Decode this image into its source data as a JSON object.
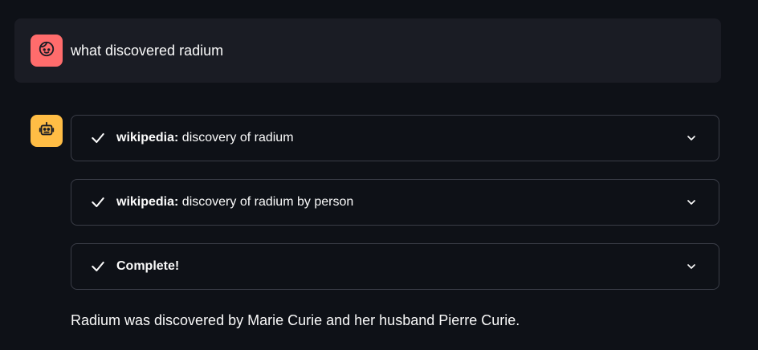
{
  "user_message": {
    "text": "what discovered radium",
    "avatar_icon": "user-face-icon",
    "avatar_color": "#ff6c6c"
  },
  "assistant": {
    "avatar_icon": "robot-icon",
    "avatar_color": "#ffbd45",
    "steps": [
      {
        "source": "wikipedia:",
        "query": " discovery of radium",
        "status_icon": "check-icon",
        "toggle_icon": "chevron-down-icon"
      },
      {
        "source": "wikipedia:",
        "query": " discovery of radium by person",
        "status_icon": "check-icon",
        "toggle_icon": "chevron-down-icon"
      },
      {
        "source": "Complete!",
        "query": "",
        "status_icon": "check-icon",
        "toggle_icon": "chevron-down-icon"
      }
    ],
    "answer": "Radium was discovered by Marie Curie and her husband Pierre Curie."
  },
  "colors": {
    "background": "#0e1117",
    "user_bubble": "#1a1c24",
    "border": "#3a3d47",
    "text": "#fafafa"
  }
}
